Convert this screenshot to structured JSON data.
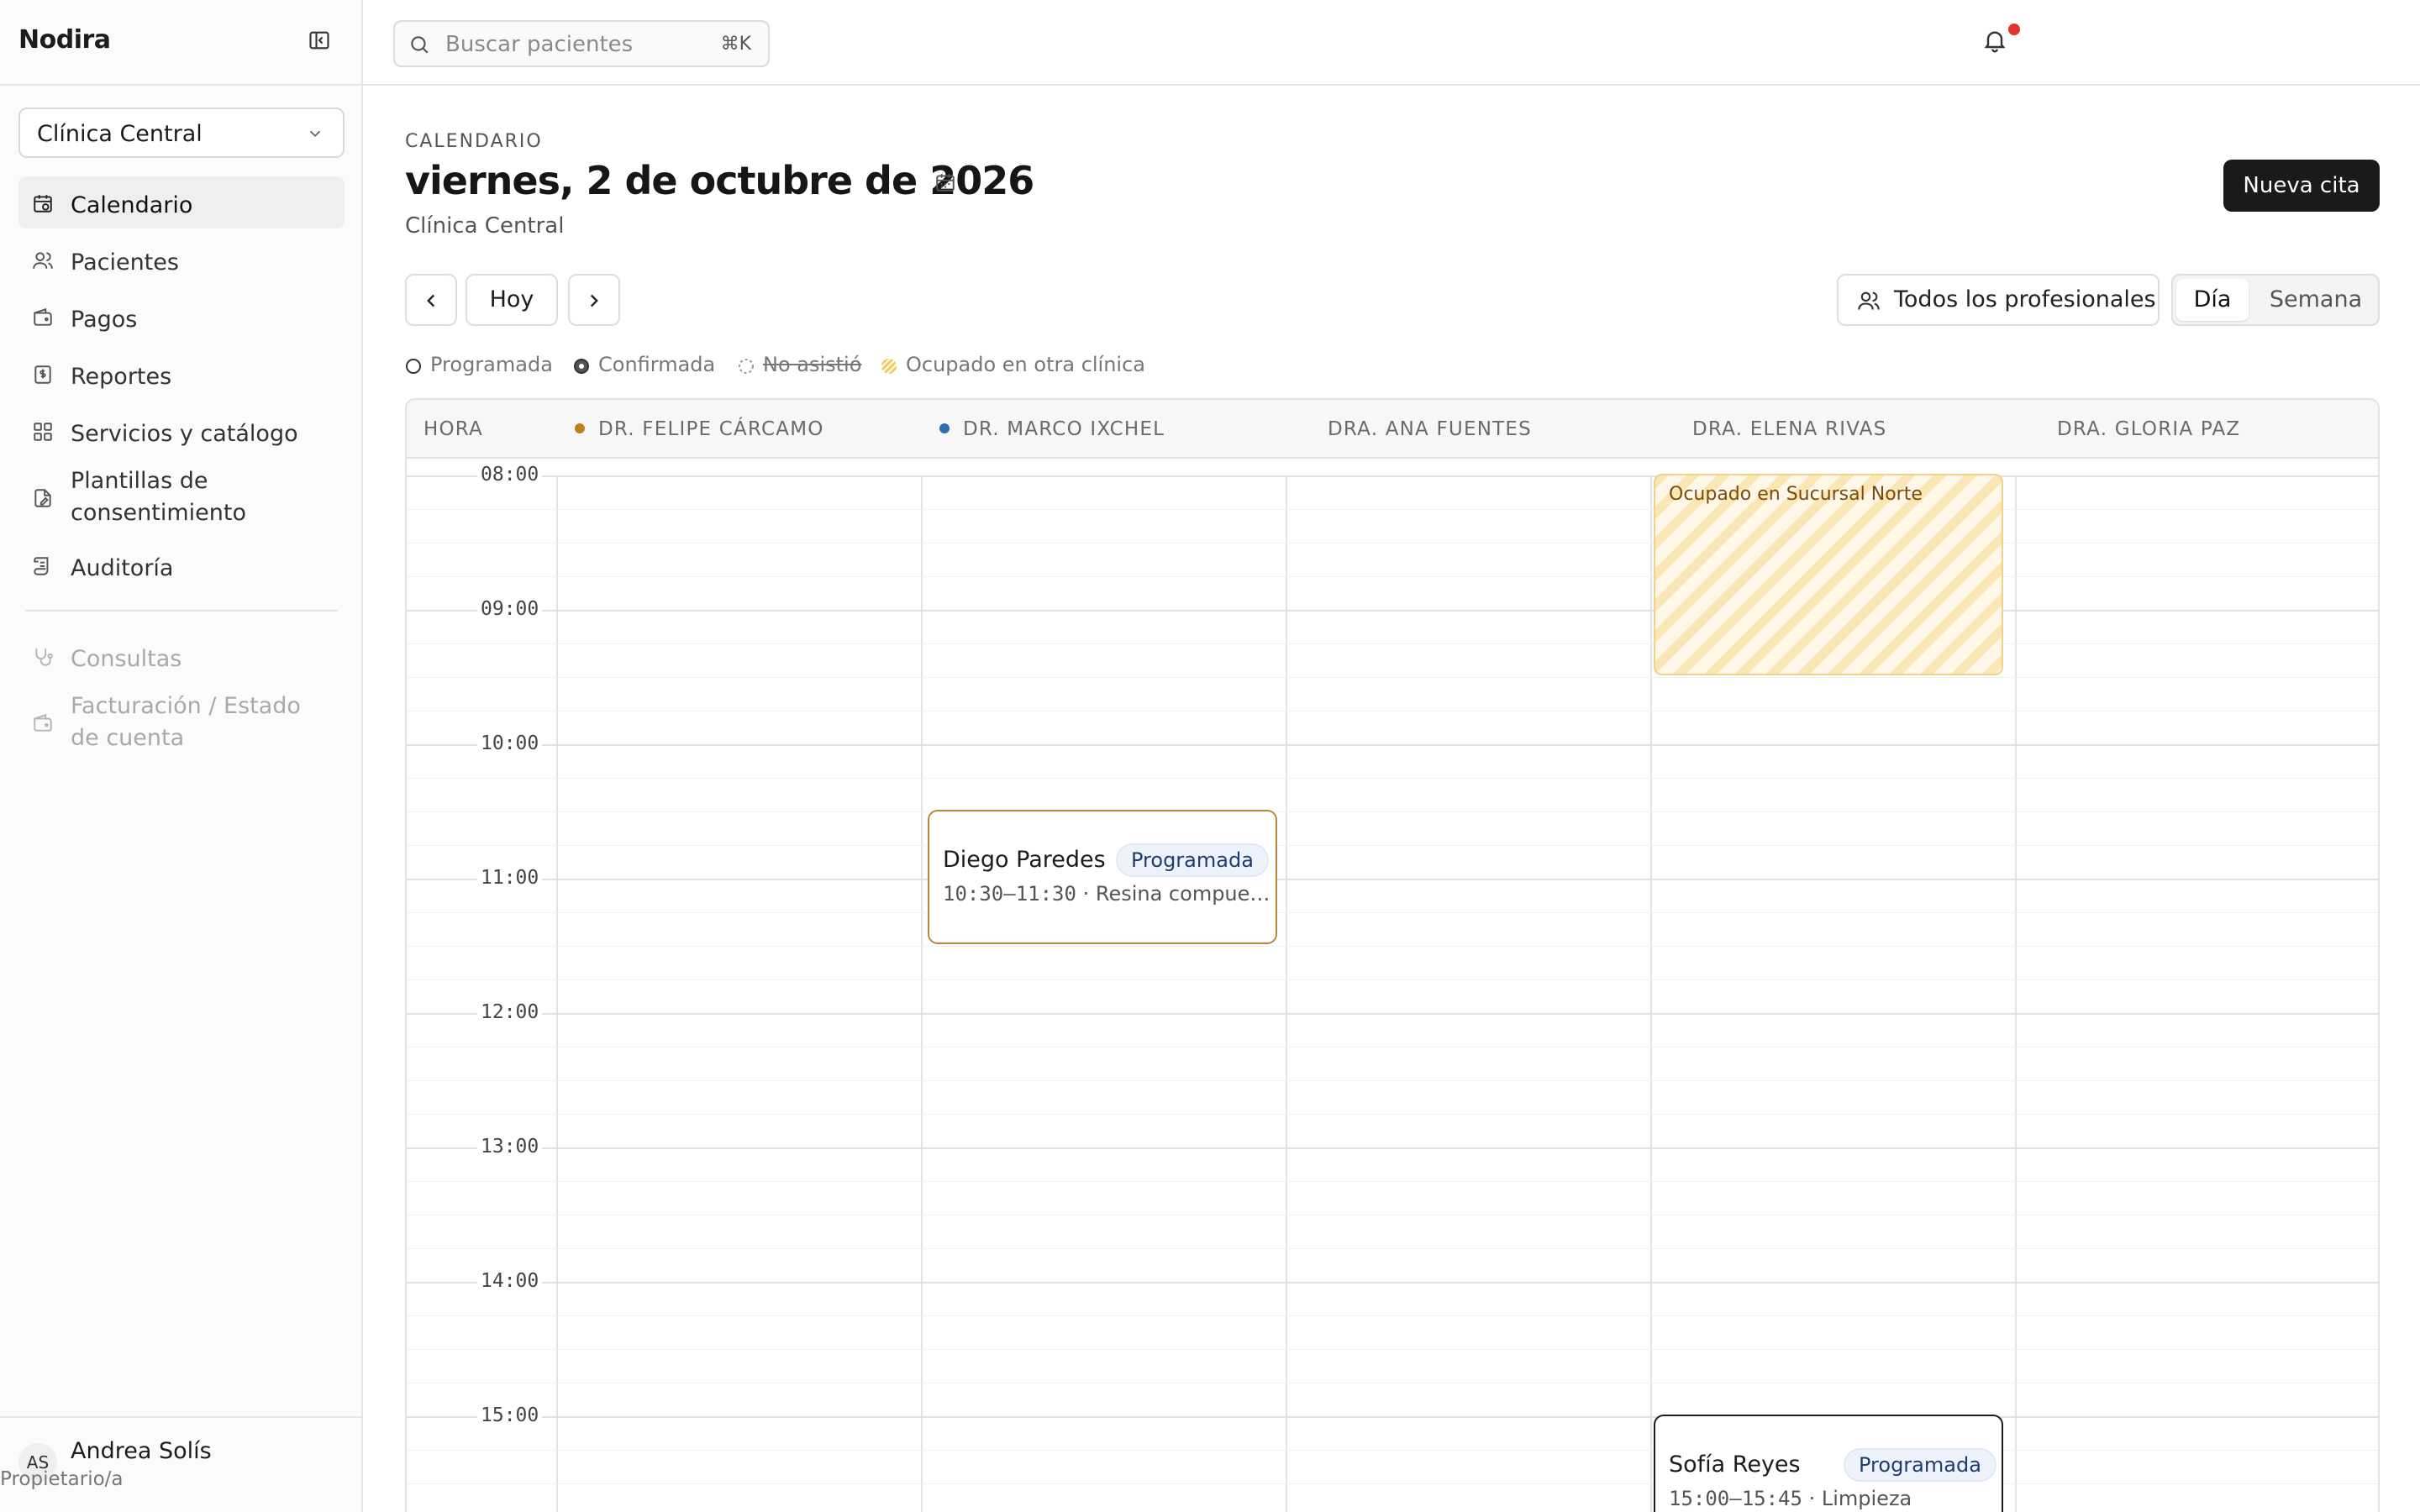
{
  "app": {
    "name": "Nodira"
  },
  "sidebar": {
    "clinic_select": {
      "value": "Clínica Central"
    },
    "items": [
      {
        "label": "Calendario",
        "icon": "calendar-icon",
        "active": true
      },
      {
        "label": "Pacientes",
        "icon": "users-icon"
      },
      {
        "label": "Pagos",
        "icon": "wallet-icon"
      },
      {
        "label": "Reportes",
        "icon": "receipt-icon"
      },
      {
        "label": "Servicios y catálogo",
        "icon": "grid-icon"
      },
      {
        "label": "Plantillas de consentimiento",
        "icon": "file-edit-icon"
      },
      {
        "label": "Auditoría",
        "icon": "log-icon"
      }
    ],
    "disabled_items": [
      {
        "label": "Consultas",
        "icon": "stethoscope-icon"
      },
      {
        "label": "Facturación / Estado de cuenta",
        "icon": "wallet-icon"
      }
    ],
    "user": {
      "initials": "AS",
      "name": "Andrea Solís",
      "role": "Propietario/a"
    }
  },
  "topbar": {
    "search": {
      "placeholder": "Buscar pacientes",
      "shortcut": "⌘K"
    },
    "notification_indicator_color": "#e0342b"
  },
  "header": {
    "eyebrow": "CALENDARIO",
    "date_title": "viernes, 2 de octubre de 2026",
    "clinic": "Clínica Central",
    "new_button": "Nueva cita"
  },
  "toolbar": {
    "today": "Hoy",
    "professionals": "Todos los profesionales",
    "views": {
      "day": "Día",
      "week": "Semana",
      "selected": "Día"
    }
  },
  "legend": {
    "scheduled": "Programada",
    "confirmed": "Confirmada",
    "no_show": "No asistió",
    "busy_other": "Ocupado en otra clínica"
  },
  "calendar": {
    "hour_header": "HORA",
    "columns": [
      {
        "label": "DR. FELIPE CÁRCAMO",
        "dot_color": "#c47c1c"
      },
      {
        "label": "DR. MARCO IXCHEL",
        "dot_color": "#2e6db4"
      },
      {
        "label": "DRA. ANA FUENTES"
      },
      {
        "label": "DRA. ELENA RIVAS"
      },
      {
        "label": "DRA. GLORIA PAZ"
      }
    ],
    "hours": [
      "08:00",
      "09:00",
      "10:00",
      "11:00",
      "12:00",
      "13:00",
      "14:00",
      "15:00"
    ],
    "busy_blocks": [
      {
        "label": "Ocupado en Sucursal Norte",
        "column": "DRA. ELENA RIVAS"
      }
    ],
    "appointments": [
      {
        "patient": "Diego Paredes",
        "status": "Programada",
        "time": "10:30–11:30",
        "service": "· Resina compue…",
        "column": "DR. MARCO IXCHEL",
        "accent": "#b9873a"
      },
      {
        "patient": "Sofía Reyes",
        "status": "Programada",
        "time": "15:00–15:45",
        "service": "· Limpieza",
        "column": "DRA. ELENA RIVAS",
        "accent": "#1d1d1d"
      }
    ]
  }
}
